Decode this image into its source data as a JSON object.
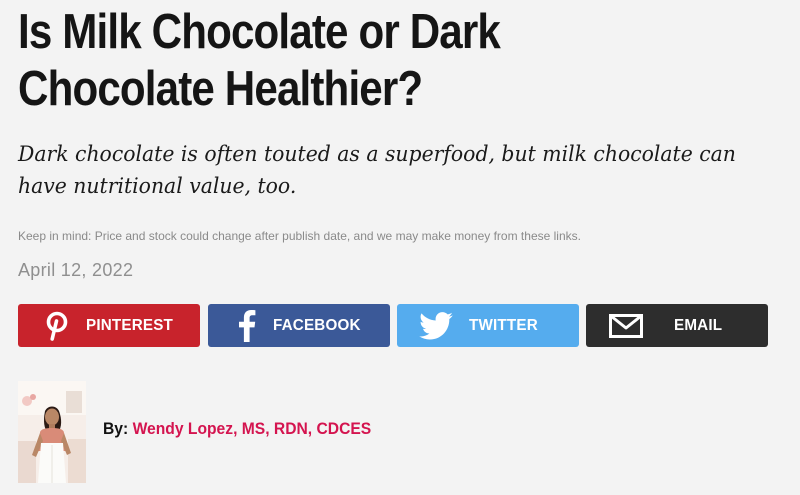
{
  "article": {
    "headline": "Is Milk Chocolate or Dark Chocolate Healthier?",
    "dek": "Dark chocolate is often touted as a superfood, but milk chocolate can have nutritional value, too.",
    "disclaimer": "Keep in mind: Price and stock could change after publish date, and we may make money from these links.",
    "date": "April 12, 2022"
  },
  "share": {
    "pinterest": {
      "label": "PINTEREST",
      "icon": "pinterest-icon",
      "color": "#c8232c"
    },
    "facebook": {
      "label": "FACEBOOK",
      "icon": "facebook-icon",
      "color": "#3b5998"
    },
    "twitter": {
      "label": "TWITTER",
      "icon": "twitter-icon",
      "color": "#55acee"
    },
    "email": {
      "label": "EMAIL",
      "icon": "email-icon",
      "color": "#2d2d2d"
    }
  },
  "byline": {
    "prefix": "By:",
    "author": "Wendy Lopez, MS, RDN, CDCES",
    "author_color": "#d4144f"
  }
}
